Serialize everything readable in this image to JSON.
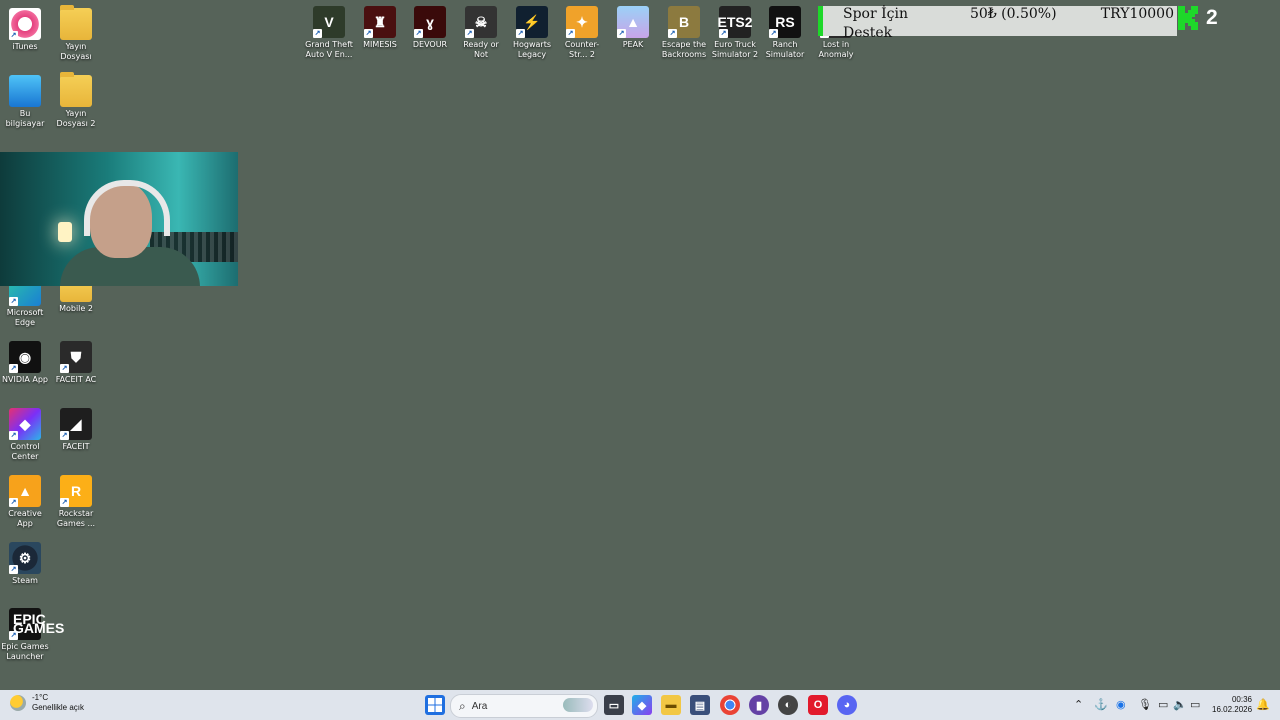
{
  "desktop": {
    "left_column": [
      {
        "name": "iTunes",
        "icon": "itunes-icon",
        "glyph": "♪"
      },
      {
        "name": "Bu bilgisayar",
        "icon": "this-pc-icon",
        "glyph": ""
      },
      {
        "name": "Microsoft Edge",
        "icon": "edge-icon",
        "glyph": "e"
      },
      {
        "name": "NVIDIA App",
        "icon": "nvidia-icon",
        "glyph": "◉"
      },
      {
        "name": "Control Center",
        "icon": "control-center-icon",
        "glyph": "◆"
      },
      {
        "name": "Creative App",
        "icon": "creative-app-icon",
        "glyph": "▲"
      },
      {
        "name": "Steam",
        "icon": "steam-icon",
        "glyph": "⚙"
      },
      {
        "name": "Epic Games Launcher",
        "icon": "epic-games-icon",
        "glyph": "EPIC GAMES"
      }
    ],
    "second_column": [
      {
        "name": "Yayın Dosyası",
        "icon": "folder-icon",
        "glyph": ""
      },
      {
        "name": "Yayın Dosyası 2",
        "icon": "folder-icon",
        "glyph": ""
      },
      {
        "name": "Mobile 2",
        "icon": "folder-icon",
        "glyph": ""
      },
      {
        "name": "FACEIT AC",
        "icon": "faceit-ac-icon",
        "glyph": "⛊"
      },
      {
        "name": "FACEIT",
        "icon": "faceit-icon",
        "glyph": "◢"
      },
      {
        "name": "Rockstar Games ...",
        "icon": "rockstar-icon",
        "glyph": "R"
      }
    ],
    "top_row": [
      {
        "name": "Grand Theft Auto V En...",
        "icon": "gta-v-icon",
        "glyph": "V"
      },
      {
        "name": "MIMESIS",
        "icon": "mimesis-icon",
        "glyph": "♜"
      },
      {
        "name": "DEVOUR",
        "icon": "devour-icon",
        "glyph": "ɣ"
      },
      {
        "name": "Ready or Not",
        "icon": "ready-or-not-icon",
        "glyph": "☠"
      },
      {
        "name": "Hogwarts Legacy",
        "icon": "hogwarts-icon",
        "glyph": "⚡"
      },
      {
        "name": "Counter-Str... 2",
        "icon": "cs2-icon",
        "glyph": "✦"
      },
      {
        "name": "PEAK",
        "icon": "peak-icon",
        "glyph": "▲"
      },
      {
        "name": "Escape the Backrooms",
        "icon": "escape-backrooms-icon",
        "glyph": "B"
      },
      {
        "name": "Euro Truck Simulator 2",
        "icon": "euro-truck-icon",
        "glyph": "ETS2"
      },
      {
        "name": "Ranch Simulator",
        "icon": "ranch-simulator-icon",
        "glyph": "RS"
      },
      {
        "name": "Lost in Anomaly",
        "icon": "lost-in-anomaly-icon",
        "glyph": "◼"
      }
    ]
  },
  "donation": {
    "name": "Spor İçin Destek",
    "amount": "50₺ (0.50%)",
    "goal": "TRY10000",
    "kick_count": "2",
    "accent_color": "#1ed82a"
  },
  "taskbar": {
    "weather_temp": "-1°C",
    "weather_desc": "Genellikle açık",
    "search_placeholder": "Ara",
    "time": "00:36",
    "date": "16.02.2026",
    "pinned": [
      "task-view-icon",
      "copilot-icon",
      "file-explorer-icon",
      "store-icon",
      "chrome-icon",
      "twitch-icon",
      "app-icon",
      "opera-icon",
      "discord-icon"
    ]
  }
}
